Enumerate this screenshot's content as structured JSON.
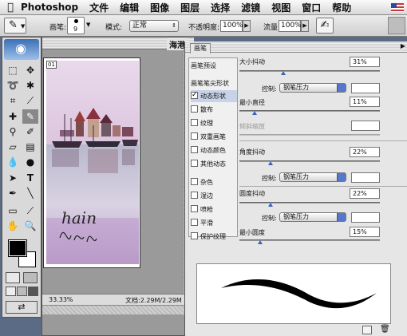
{
  "menu": {
    "app": "Photoshop",
    "items": [
      "文件",
      "编辑",
      "图像",
      "图层",
      "选择",
      "滤镜",
      "视图",
      "窗口",
      "帮助"
    ]
  },
  "options": {
    "brush_label": "画笔:",
    "brush_size": "9",
    "mode_label": "模式:",
    "mode_value": "正常",
    "opacity_label": "不透明度:",
    "opacity_value": "100%",
    "flow_label": "流量:",
    "flow_value": "100%"
  },
  "document": {
    "title": "海港",
    "layer_tag": "01",
    "zoom": "33.33%",
    "file_info": "文档:2.29M/2.29M",
    "signature": "hain"
  },
  "brush_panel": {
    "tab": "画笔",
    "list_header": "画笔预设",
    "list_sub": "画笔笔尖形状",
    "items": [
      {
        "label": "动态形状",
        "checked": true
      },
      {
        "label": "散布",
        "checked": false
      },
      {
        "label": "纹理",
        "checked": false
      },
      {
        "label": "双重画笔",
        "checked": false
      },
      {
        "label": "动态颜色",
        "checked": false
      },
      {
        "label": "其他动态",
        "checked": false
      },
      {
        "label": "杂色",
        "checked": false
      },
      {
        "label": "湿边",
        "checked": false
      },
      {
        "label": "喷枪",
        "checked": false
      },
      {
        "label": "平滑",
        "checked": false
      },
      {
        "label": "保护纹理",
        "checked": false
      }
    ],
    "size_jitter_label": "大小抖动",
    "size_jitter": "31%",
    "size_jitter_level": 0.31,
    "control_label": "控制:",
    "control_value": "钢笔压力",
    "min_diameter_label": "最小直径",
    "min_diameter": "11%",
    "min_diameter_level": 0.11,
    "tilt_scale_label": "倾斜缩放",
    "angle_jitter_label": "角度抖动",
    "angle_jitter": "22%",
    "angle_jitter_level": 0.22,
    "roundness_jitter_label": "圆度抖动",
    "roundness_jitter": "22%",
    "roundness_jitter_level": 0.22,
    "min_roundness_label": "最小圆度",
    "min_roundness": "15%",
    "min_roundness_level": 0.15
  },
  "colors": {
    "accent": "#3a66b8",
    "foreground": "#000000",
    "background": "#ffffff"
  }
}
